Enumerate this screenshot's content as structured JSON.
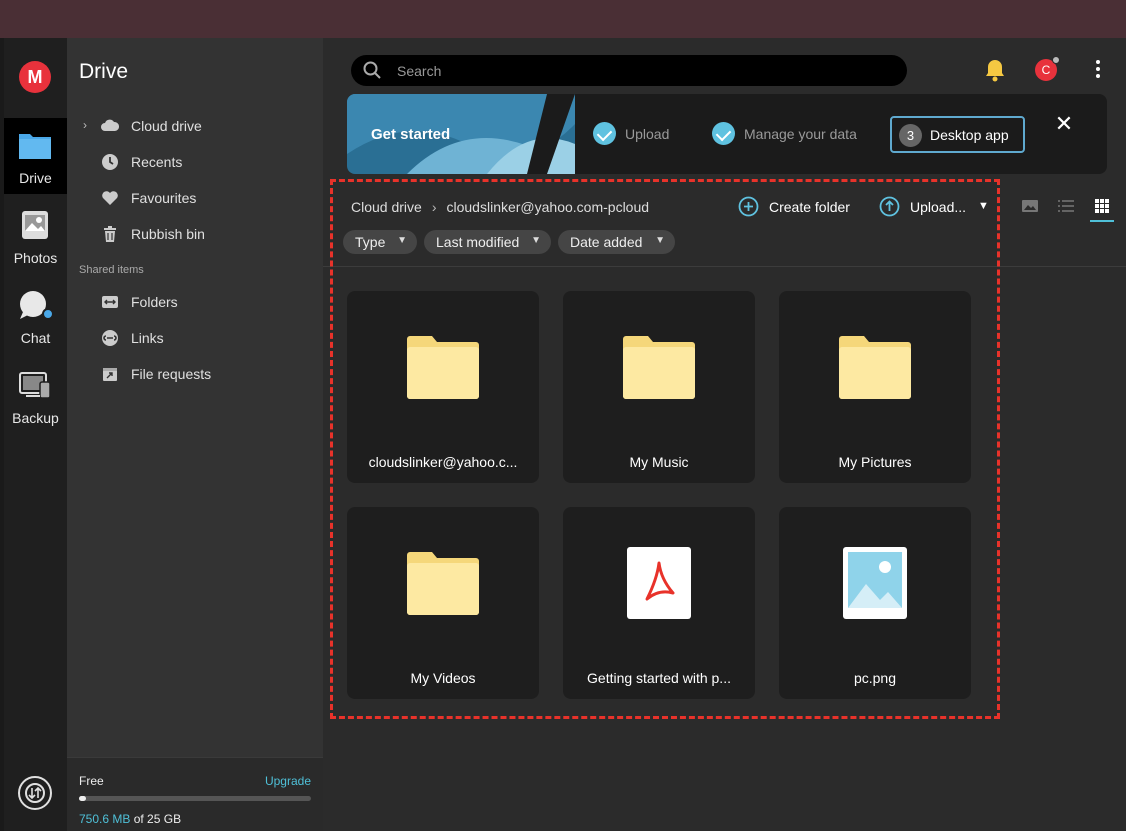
{
  "rail": {
    "logo": "M",
    "items": [
      {
        "label": "Drive",
        "icon": "folder-icon"
      },
      {
        "label": "Photos",
        "icon": "photos-icon"
      },
      {
        "label": "Chat",
        "icon": "chat-icon"
      },
      {
        "label": "Backup",
        "icon": "backup-icon"
      }
    ]
  },
  "sidebar": {
    "title": "Drive",
    "items": [
      {
        "label": "Cloud drive",
        "icon": "cloud-icon"
      },
      {
        "label": "Recents",
        "icon": "clock-icon"
      },
      {
        "label": "Favourites",
        "icon": "heart-icon"
      },
      {
        "label": "Rubbish bin",
        "icon": "trash-icon"
      }
    ],
    "shared_section": "Shared items",
    "shared_items": [
      {
        "label": "Folders",
        "icon": "shared-folder-icon"
      },
      {
        "label": "Links",
        "icon": "link-icon"
      },
      {
        "label": "File requests",
        "icon": "file-request-icon"
      }
    ],
    "footer": {
      "plan": "Free",
      "upgrade": "Upgrade",
      "used": "750.6 MB",
      "of_total": " of 25 GB",
      "usage_fraction": 0.03
    }
  },
  "header": {
    "search_placeholder": "Search",
    "avatar_initial": "C"
  },
  "banner": {
    "title": "Get started",
    "steps": [
      {
        "label": "Upload",
        "done": true
      },
      {
        "label": "Manage your data",
        "done": true
      }
    ],
    "active_step": {
      "number": "3",
      "label": "Desktop app"
    },
    "close": "✕"
  },
  "toolbar": {
    "breadcrumb": [
      "Cloud drive",
      "cloudslinker@yahoo.com-pcloud"
    ],
    "create_folder": "Create folder",
    "upload": "Upload...",
    "filters": [
      "Type",
      "Last modified",
      "Date added"
    ]
  },
  "files": [
    {
      "name": "cloudslinker@yahoo.c...",
      "kind": "folder"
    },
    {
      "name": "My Music",
      "kind": "folder"
    },
    {
      "name": "My Pictures",
      "kind": "folder"
    },
    {
      "name": "My Videos",
      "kind": "folder"
    },
    {
      "name": "Getting started with p...",
      "kind": "pdf"
    },
    {
      "name": "pc.png",
      "kind": "image"
    }
  ],
  "colors": {
    "accent": "#4fc0d8",
    "brand": "#e8323c",
    "highlight": "#e8322a",
    "folder": "#fde9a2"
  }
}
